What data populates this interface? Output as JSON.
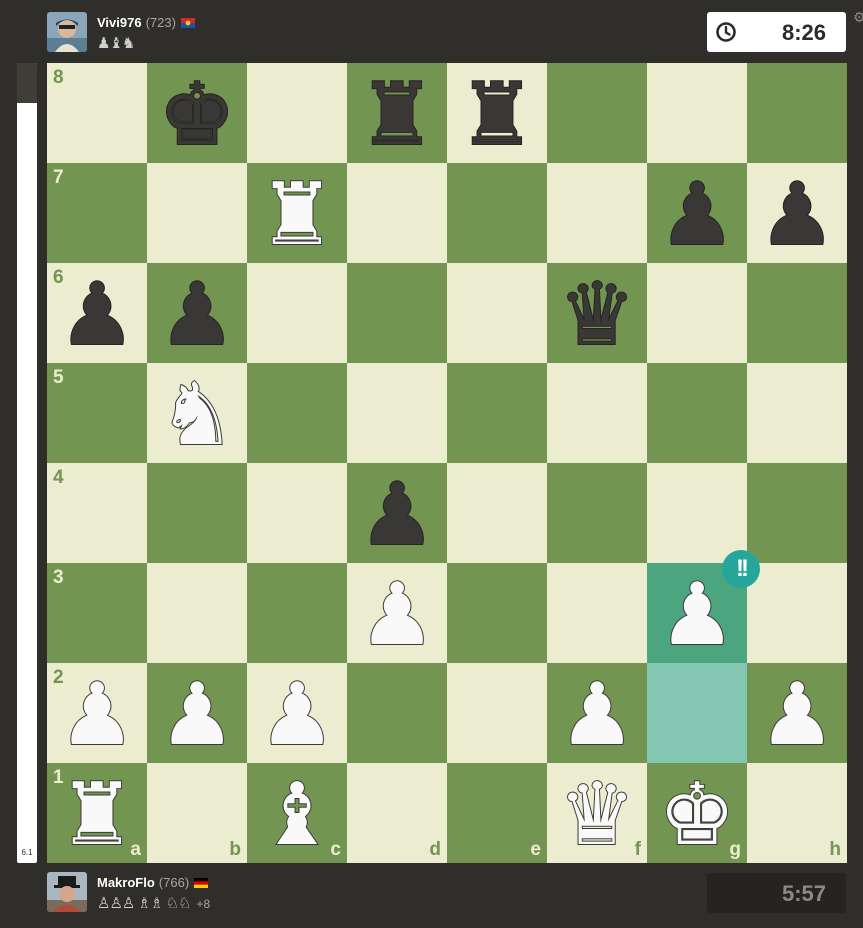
{
  "top_player": {
    "name": "Vivi976",
    "rating": "(723)",
    "captured": "♟♝♞",
    "clock": "8:26"
  },
  "bottom_player": {
    "name": "MakroFlo",
    "rating": "(766)",
    "captured": "♙♙♙ ♗♗ ♘♘",
    "advantage": "+8",
    "clock": "5:57"
  },
  "evaluation": {
    "score": "6.1",
    "black_fraction": 0.05
  },
  "board": {
    "files": [
      "a",
      "b",
      "c",
      "d",
      "e",
      "f",
      "g",
      "h"
    ],
    "ranks": [
      "8",
      "7",
      "6",
      "5",
      "4",
      "3",
      "2",
      "1"
    ],
    "highlight": [
      "g3",
      "g2"
    ],
    "move_badge": "!!",
    "move_badge_square": "g3",
    "pieces": {
      "b8": "bk",
      "d8": "br",
      "e8": "br",
      "c7": "wr",
      "g7": "bp",
      "h7": "bp",
      "a6": "bp",
      "b6": "bp",
      "f6": "bq",
      "b5": "wn",
      "d4": "bp",
      "d3": "wp",
      "g3": "wp",
      "a2": "wp",
      "b2": "wp",
      "c2": "wp",
      "f2": "wp",
      "h2": "wp",
      "a1": "wr",
      "c1": "wb",
      "f1": "wq",
      "g1": "wk"
    }
  },
  "colors": {
    "light_square": "#ebecd0",
    "dark_square": "#739552",
    "highlight_light": "#84c8b4",
    "highlight_dark": "#4ba57f",
    "badge": "#26a69a"
  }
}
